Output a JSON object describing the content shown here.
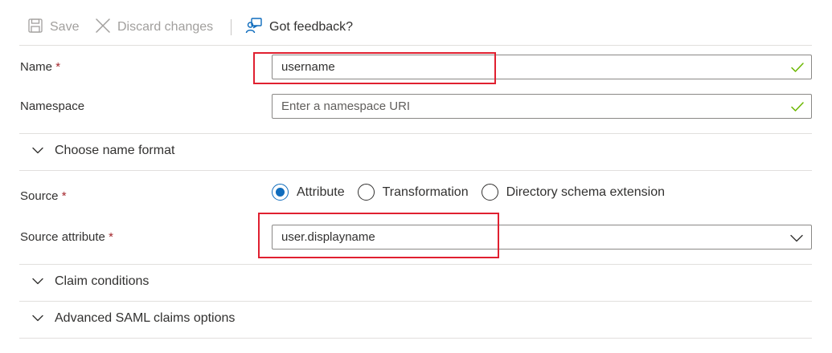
{
  "toolbar": {
    "save_label": "Save",
    "discard_label": "Discard changes",
    "feedback_label": "Got feedback?"
  },
  "name_field": {
    "label": "Name",
    "required_mark": "*",
    "value": "username"
  },
  "namespace_field": {
    "label": "Namespace",
    "placeholder": "Enter a namespace URI"
  },
  "name_format": {
    "label": "Choose name format"
  },
  "source": {
    "label": "Source",
    "required_mark": "*",
    "options": [
      "Attribute",
      "Transformation",
      "Directory schema extension"
    ],
    "selected": "Attribute"
  },
  "source_attribute": {
    "label": "Source attribute",
    "required_mark": "*",
    "value": "user.displayname"
  },
  "claim_conditions": {
    "label": "Claim conditions"
  },
  "advanced_saml": {
    "label": "Advanced SAML claims options"
  },
  "colors": {
    "accent": "#0f6cbd",
    "valid_check": "#6bb700",
    "highlight": "#e02030",
    "required": "#a4262c"
  }
}
